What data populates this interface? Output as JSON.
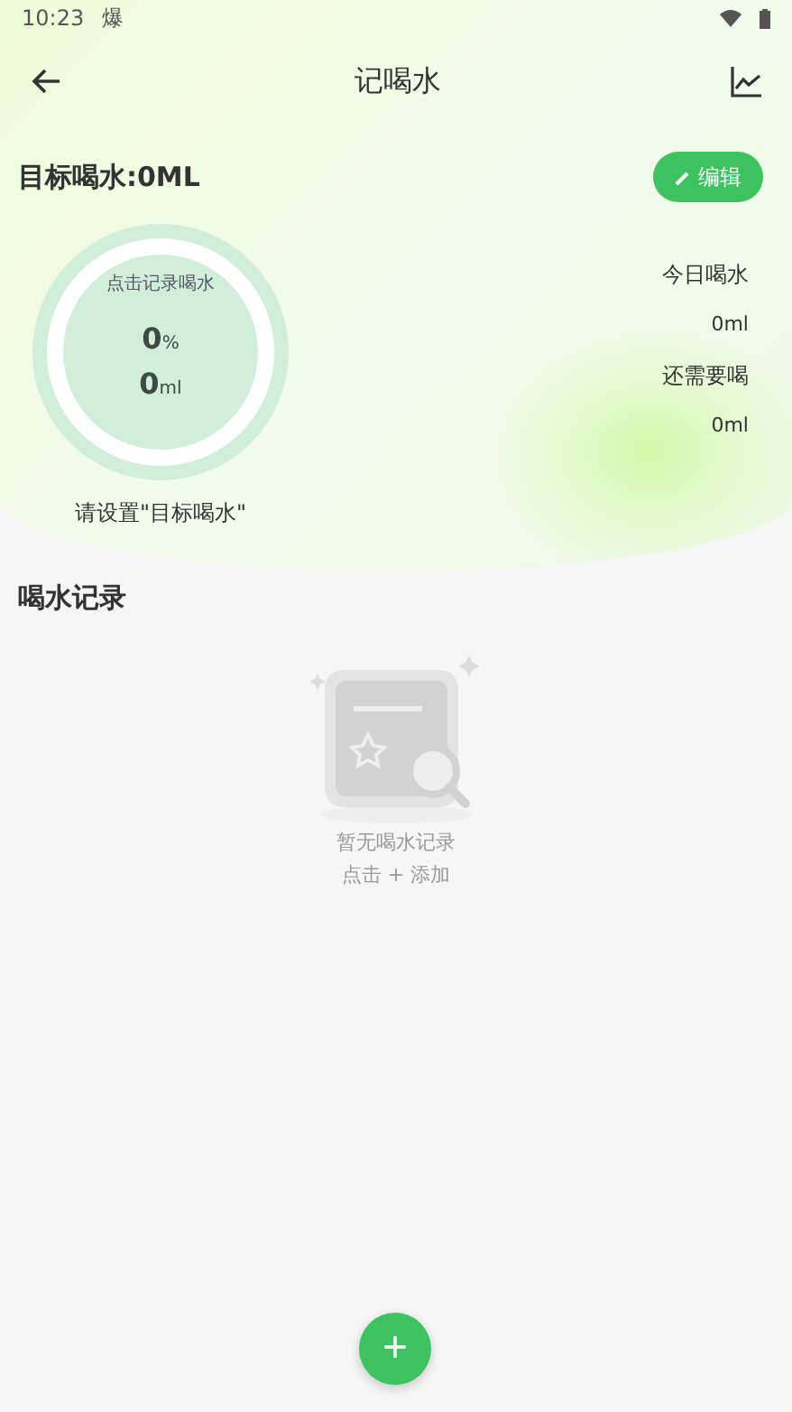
{
  "status_bar": {
    "time": "10:23",
    "notification": "爆"
  },
  "header": {
    "title": "记喝水"
  },
  "goal": {
    "label": "目标喝水:0ML",
    "edit_button": "编辑"
  },
  "ring": {
    "hint": "点击记录喝水",
    "percent": "0",
    "percent_unit": "%",
    "amount": "0",
    "amount_unit": "ml",
    "level": 0,
    "caption": "请设置\"目标喝水\""
  },
  "stats": [
    {
      "label": "今日喝水",
      "value": "0ml"
    },
    {
      "label": "还需要喝",
      "value": "0ml"
    }
  ],
  "records": {
    "title": "喝水记录",
    "empty_lines": [
      "暂无喝水记录",
      "点击 + 添加"
    ]
  },
  "fab": {
    "label": "+"
  }
}
